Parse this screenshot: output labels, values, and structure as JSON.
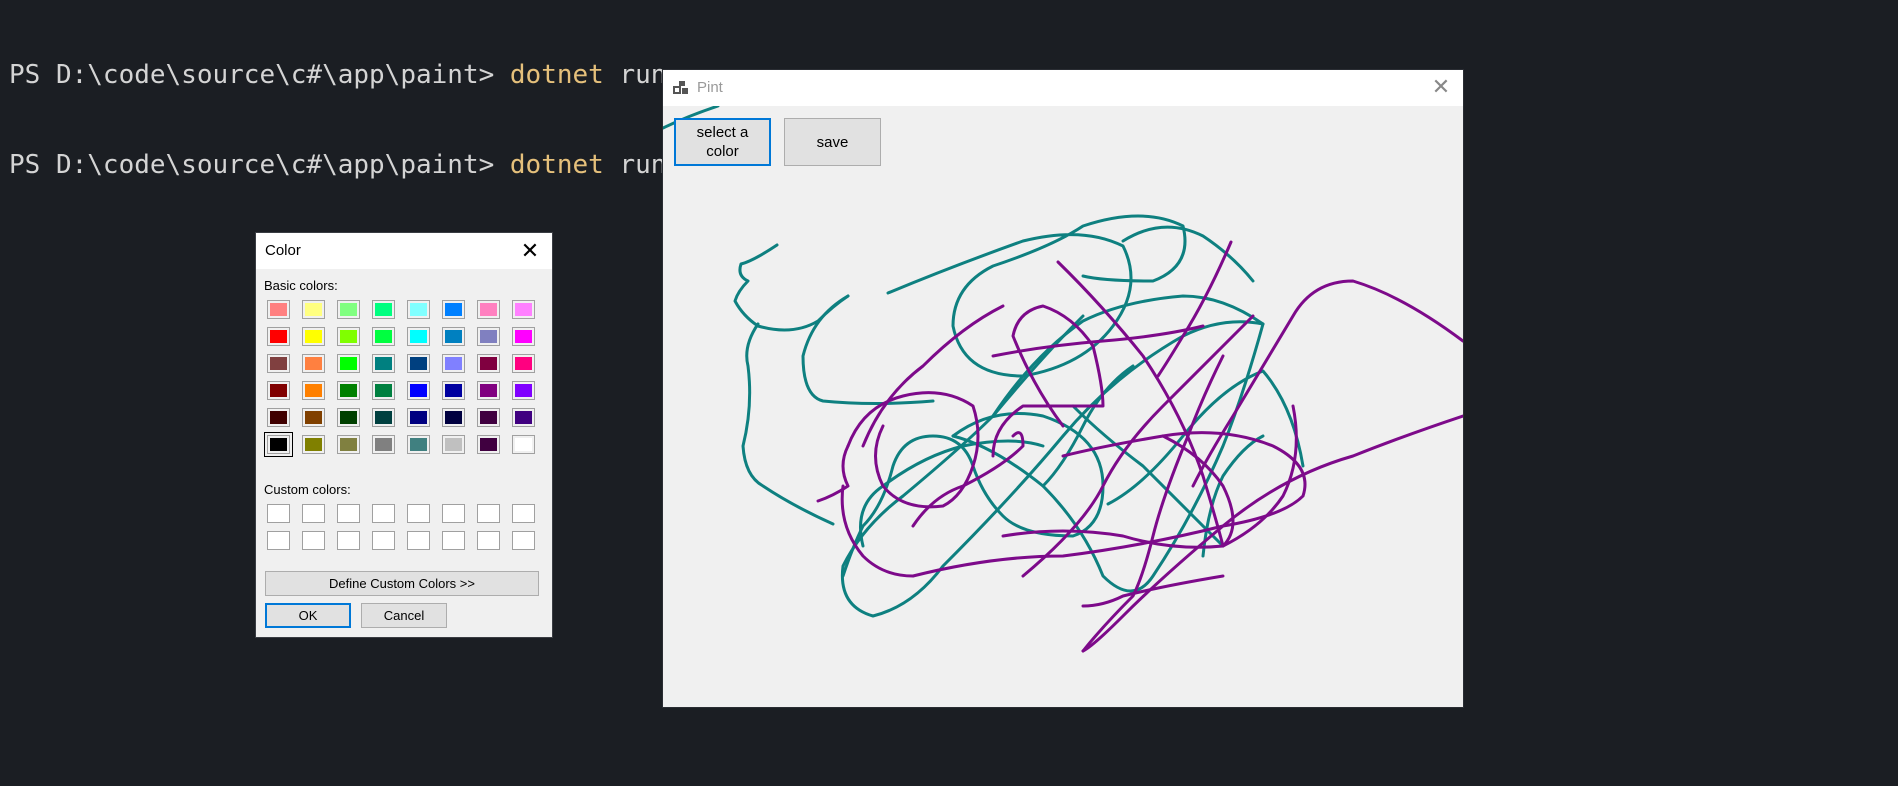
{
  "terminal": {
    "lines": [
      {
        "prompt": "PS D:\\code\\source\\c#\\app\\paint> ",
        "command": "dotnet",
        "args": " run"
      },
      {
        "prompt": "PS D:\\code\\source\\c#\\app\\paint> ",
        "command": "dotnet",
        "args": " run"
      }
    ]
  },
  "paint_window": {
    "title": "Pint",
    "close_glyph": "✕",
    "select_color_label": "select a color",
    "save_label": "save",
    "stroke_colors": {
      "teal": "#0e8080",
      "purple": "#7d0a8a"
    }
  },
  "color_dialog": {
    "title": "Color",
    "close_glyph": "✕",
    "basic_colors_label": "Basic colors:",
    "custom_colors_label": "Custom colors:",
    "define_button": "Define Custom Colors >>",
    "ok_button": "OK",
    "cancel_button": "Cancel",
    "basic_colors": [
      [
        "#ff8080",
        "#ffff80",
        "#80ff80",
        "#00ff80",
        "#80ffff",
        "#0080ff",
        "#ff80c0",
        "#ff80ff"
      ],
      [
        "#ff0000",
        "#ffff00",
        "#80ff00",
        "#00ff40",
        "#00ffff",
        "#0080c0",
        "#8080c0",
        "#ff00ff"
      ],
      [
        "#804040",
        "#ff8040",
        "#00ff00",
        "#008080",
        "#004080",
        "#8080ff",
        "#800040",
        "#ff0080"
      ],
      [
        "#800000",
        "#ff8000",
        "#008000",
        "#008040",
        "#0000ff",
        "#0000a0",
        "#800080",
        "#8000ff"
      ],
      [
        "#400000",
        "#804000",
        "#004000",
        "#004040",
        "#000080",
        "#000040",
        "#400040",
        "#400080"
      ],
      [
        "#000000",
        "#808000",
        "#808040",
        "#808080",
        "#408080",
        "#c0c0c0",
        "#400040",
        "#ffffff"
      ]
    ],
    "selected_color": "#000000"
  }
}
